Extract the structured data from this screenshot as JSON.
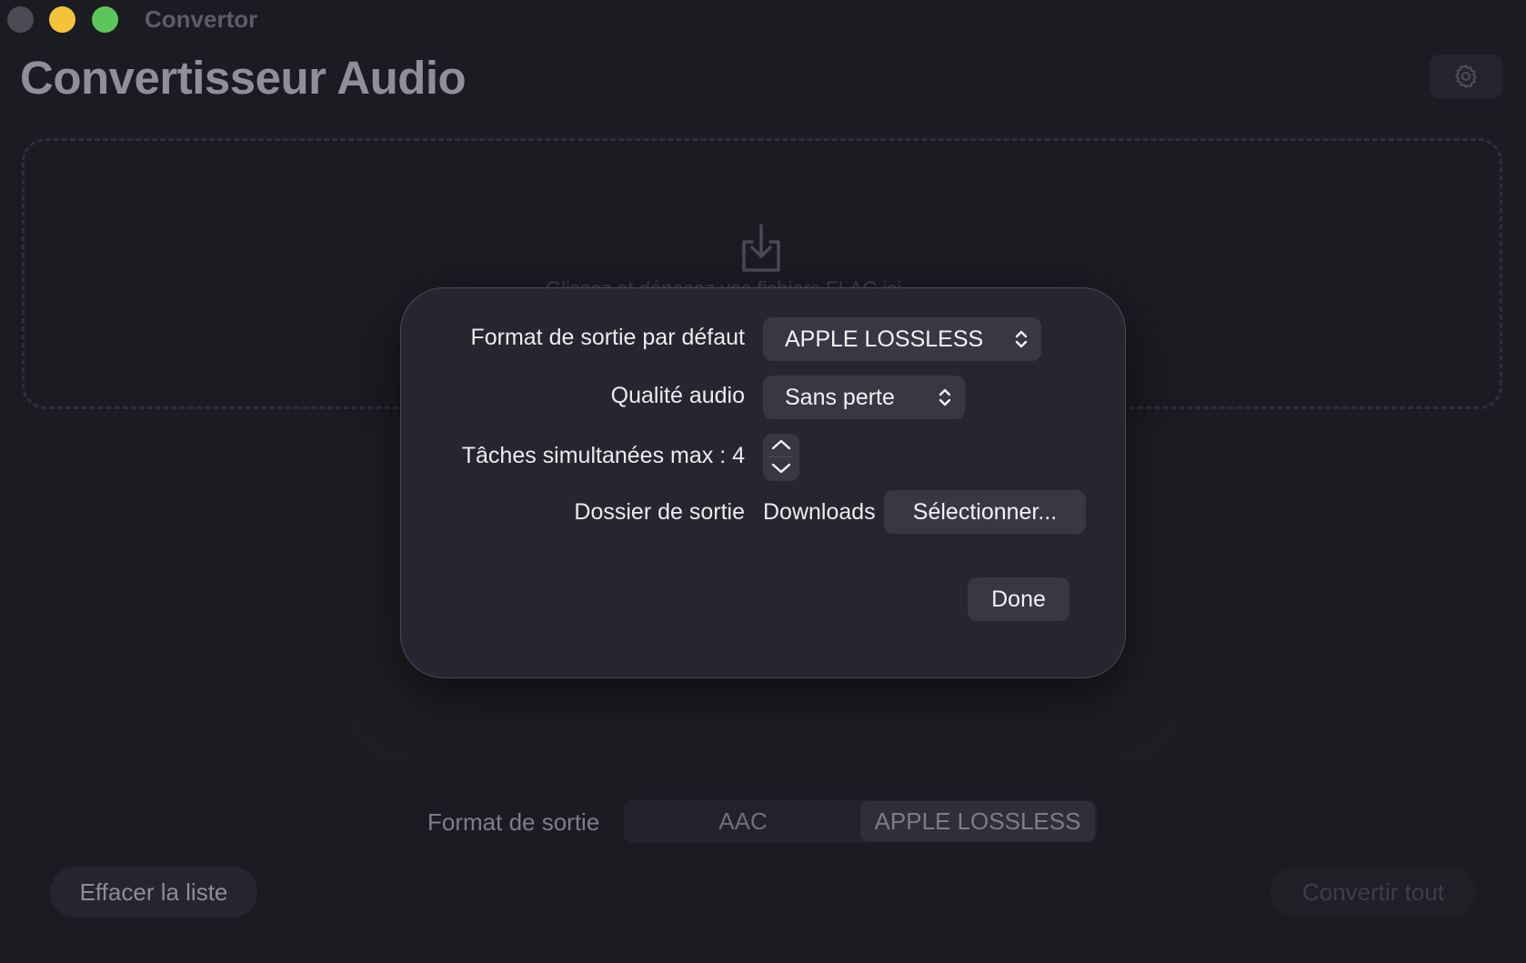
{
  "window": {
    "title": "Convertor"
  },
  "main": {
    "title": "Convertisseur Audio",
    "drop_hint": "Glissez et déposez vos fichiers FLAC ici",
    "output_format_label": "Format de sortie",
    "formats": [
      {
        "label": "AAC",
        "selected": false
      },
      {
        "label": "APPLE LOSSLESS",
        "selected": true
      }
    ],
    "clear_label": "Effacer la liste",
    "convert_label": "Convertir tout"
  },
  "settings": {
    "default_format_label": "Format de sortie par défaut",
    "default_format_value": "APPLE LOSSLESS",
    "quality_label": "Qualité audio",
    "quality_value": "Sans perte",
    "max_tasks_label": "Tâches simultanées max : 4",
    "output_folder_label": "Dossier de sortie",
    "output_folder_value": "Downloads",
    "select_label": "Sélectionner...",
    "done_label": "Done"
  },
  "icons": {
    "settings": "gear-icon",
    "drop": "download-tray-icon",
    "popup": "chevron-up-down-icon",
    "stepper_up": "chevron-up-icon",
    "stepper_down": "chevron-down-icon"
  },
  "colors": {
    "background": "#1b1c22",
    "modal_background": "#25262f",
    "control_background": "#373843",
    "close": "#4a4b55",
    "minimize": "#f5c33b",
    "maximize": "#5dc65a"
  }
}
